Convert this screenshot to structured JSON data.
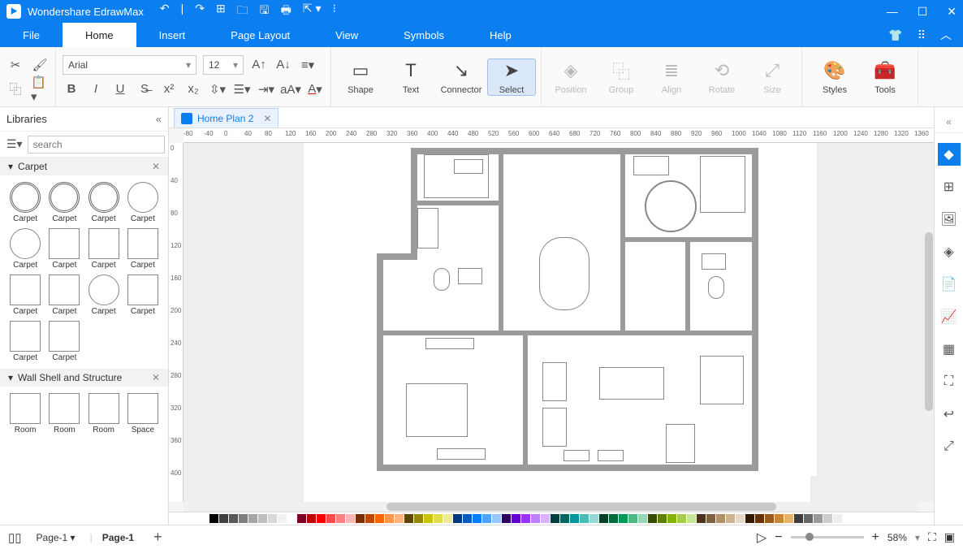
{
  "app": {
    "title": "Wondershare EdrawMax"
  },
  "menubar": {
    "items": [
      "File",
      "Home",
      "Insert",
      "Page Layout",
      "View",
      "Symbols",
      "Help"
    ],
    "activeIndex": 1
  },
  "ribbon": {
    "font": "Arial",
    "size": "12",
    "tools": [
      {
        "label": "Shape"
      },
      {
        "label": "Text"
      },
      {
        "label": "Connector"
      },
      {
        "label": "Select",
        "active": true
      }
    ],
    "arrange": [
      {
        "label": "Position"
      },
      {
        "label": "Group"
      },
      {
        "label": "Align"
      },
      {
        "label": "Rotate"
      },
      {
        "label": "Size"
      }
    ],
    "right": [
      {
        "label": "Styles"
      },
      {
        "label": "Tools"
      }
    ]
  },
  "libraries": {
    "title": "Libraries",
    "searchPlaceholder": "search",
    "categories": [
      {
        "name": "Carpet",
        "items": [
          "Carpet",
          "Carpet",
          "Carpet",
          "Carpet",
          "Carpet",
          "Carpet",
          "Carpet",
          "Carpet",
          "Carpet",
          "Carpet",
          "Carpet",
          "Carpet",
          "Carpet",
          "Carpet"
        ]
      },
      {
        "name": "Wall Shell and Structure",
        "items": [
          "Room",
          "Room",
          "Room",
          "Space"
        ]
      }
    ]
  },
  "document": {
    "tabName": "Home Plan 2"
  },
  "rulerH": [
    "-80",
    "-40",
    "0",
    "40",
    "80",
    "120",
    "160",
    "200",
    "240",
    "280",
    "320",
    "360",
    "400",
    "440",
    "480",
    "520",
    "560",
    "600",
    "640",
    "680",
    "720",
    "760",
    "800",
    "840",
    "880",
    "920",
    "960",
    "1000",
    "1040",
    "1080",
    "1120",
    "1160",
    "1200",
    "1240",
    "1280",
    "1320",
    "1360"
  ],
  "rulerV": [
    "0",
    "40",
    "80",
    "120",
    "160",
    "200",
    "240",
    "280",
    "320",
    "360",
    "400"
  ],
  "statusbar": {
    "pageListLabel": "Page-1",
    "currentPage": "Page-1",
    "zoom": "58%"
  },
  "colors": [
    "#000",
    "#3f3f3f",
    "#595959",
    "#7f7f7f",
    "#a5a5a5",
    "#bfbfbf",
    "#d8d8d8",
    "#f2f2f2",
    "#fff",
    "#7e0022",
    "#c00000",
    "#ff0000",
    "#ff4d4d",
    "#ff8080",
    "#ffb3b3",
    "#7b2e00",
    "#c04800",
    "#ff6600",
    "#ff944d",
    "#ffb380",
    "#5e4600",
    "#968600",
    "#cbc200",
    "#e2dd4d",
    "#eeea99",
    "#003a7e",
    "#005cc0",
    "#0080ff",
    "#4da3ff",
    "#99c7ff",
    "#2e005e",
    "#6600cc",
    "#9933ff",
    "#bf80ff",
    "#d9b3ff",
    "#003d3d",
    "#006666",
    "#009999",
    "#4db8b8",
    "#99d6d6",
    "#004225",
    "#006b3c",
    "#009955",
    "#4db881",
    "#99d6b8",
    "#394d00",
    "#5e7f00",
    "#84b300",
    "#a6cc4d",
    "#c7e599",
    "#4d3319",
    "#806040",
    "#b38f66",
    "#ccb38c",
    "#e5d9c6",
    "#331a00",
    "#663300",
    "#995c1a",
    "#cc8533",
    "#e5b366",
    "#3d3d3d",
    "#666",
    "#999",
    "#ccc",
    "#eee"
  ]
}
